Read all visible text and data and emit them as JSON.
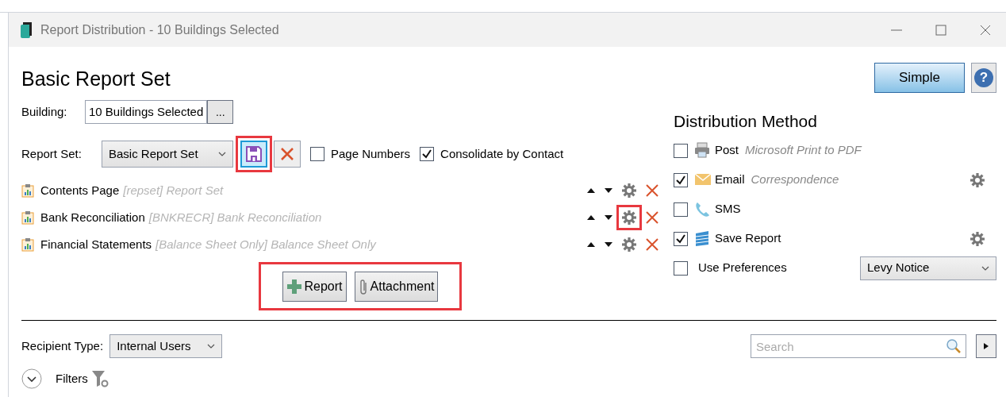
{
  "window": {
    "title": "Report Distribution - 10 Buildings Selected"
  },
  "heading": "Basic Report Set",
  "mode_button": {
    "label": "Simple"
  },
  "help_button": {
    "label": "?"
  },
  "building": {
    "label": "Building:",
    "value": "10 Buildings Selected",
    "browse": "..."
  },
  "report_set": {
    "label": "Report Set:",
    "value": "Basic Report Set",
    "save_highlighted": true
  },
  "options": [
    {
      "label": "Page Numbers",
      "checked": false
    },
    {
      "label": "Consolidate by Contact",
      "checked": true
    }
  ],
  "reports": [
    {
      "name": "Contents Page",
      "detail": "[repset] Report Set",
      "settings_highlighted": false
    },
    {
      "name": "Bank Reconciliation",
      "detail": "[BNKRECR] Bank Reconciliation",
      "settings_highlighted": true
    },
    {
      "name": "Financial Statements",
      "detail": "[Balance Sheet Only] Balance Sheet Only",
      "settings_highlighted": false
    }
  ],
  "add_buttons": {
    "highlighted": true,
    "items": [
      {
        "kind": "plus",
        "label": "Report"
      },
      {
        "kind": "paperclip",
        "label": "Attachment"
      }
    ]
  },
  "distribution": {
    "title": "Distribution Method",
    "methods": [
      {
        "kind": "printer",
        "label": "Post",
        "detail": "Microsoft Print to PDF",
        "checked": false,
        "settings": false
      },
      {
        "kind": "envelope",
        "label": "Email",
        "detail": "Correspondence",
        "checked": true,
        "settings": true
      },
      {
        "kind": "phone",
        "label": "SMS",
        "checked": false,
        "settings": false
      },
      {
        "kind": "database",
        "label": "Save Report",
        "checked": true,
        "settings": true
      }
    ],
    "preferences": {
      "label": "Use Preferences",
      "checked": false,
      "value": "Levy Notice"
    }
  },
  "recipient_type": {
    "label": "Recipient Type:",
    "value": "Internal Users"
  },
  "search": {
    "placeholder": "Search"
  },
  "filters": {
    "label": "Filters"
  }
}
